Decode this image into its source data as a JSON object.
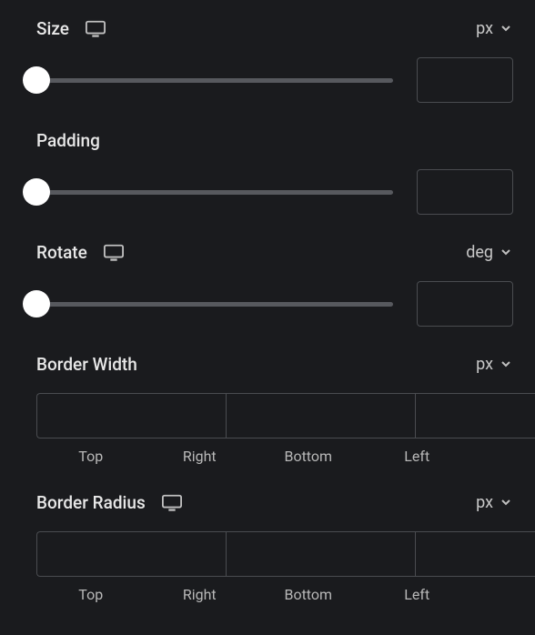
{
  "controls": {
    "size": {
      "label": "Size",
      "unit": "px",
      "value": "",
      "responsive": true
    },
    "padding": {
      "label": "Padding",
      "value": "",
      "responsive": false
    },
    "rotate": {
      "label": "Rotate",
      "unit": "deg",
      "value": "",
      "responsive": true
    },
    "border_width": {
      "label": "Border Width",
      "unit": "px",
      "sides": {
        "top": {
          "label": "Top",
          "value": ""
        },
        "right": {
          "label": "Right",
          "value": ""
        },
        "bottom": {
          "label": "Bottom",
          "value": ""
        },
        "left": {
          "label": "Left",
          "value": ""
        }
      }
    },
    "border_radius": {
      "label": "Border Radius",
      "unit": "px",
      "responsive": true,
      "sides": {
        "top": {
          "label": "Top",
          "value": ""
        },
        "right": {
          "label": "Right",
          "value": ""
        },
        "bottom": {
          "label": "Bottom",
          "value": ""
        },
        "left": {
          "label": "Left",
          "value": ""
        }
      }
    }
  }
}
